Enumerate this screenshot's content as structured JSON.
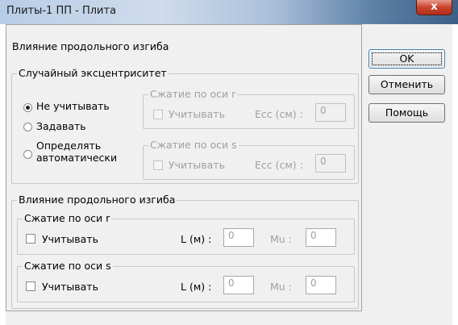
{
  "window": {
    "title": "Плиты-1 ПП - Плита",
    "close_glyph": "x"
  },
  "dialog": {
    "heading": "Влияние продольного изгиба",
    "random_eccentricity": {
      "legend": "Случайный эксцентриситет",
      "options": [
        "Не учитывать",
        "Задавать",
        "Определять автоматически"
      ],
      "selected": "Не учитывать",
      "compression_r": {
        "legend": "Сжатие по оси r",
        "checkbox_label": "Учитывать",
        "ecc_label": "Ecc (см) :",
        "ecc_value": "0"
      },
      "compression_s": {
        "legend": "Сжатие по оси s",
        "checkbox_label": "Учитывать",
        "ecc_label": "Ecc (см) :",
        "ecc_value": "0"
      }
    },
    "buckling": {
      "legend": "Влияние продольного изгиба",
      "compression_r": {
        "legend": "Сжатие по оси r",
        "checkbox_label": "Учитывать",
        "l_label": "L (м) :",
        "l_value": "0",
        "mu_label": "Mu :",
        "mu_value": "0"
      },
      "compression_s": {
        "legend": "Сжатие по оси s",
        "checkbox_label": "Учитывать",
        "l_label": "L (м) :",
        "l_value": "0",
        "mu_label": "Mu :",
        "mu_value": "0"
      }
    },
    "buttons": {
      "ok": "OK",
      "cancel": "Отменить",
      "help": "Помощь"
    }
  }
}
